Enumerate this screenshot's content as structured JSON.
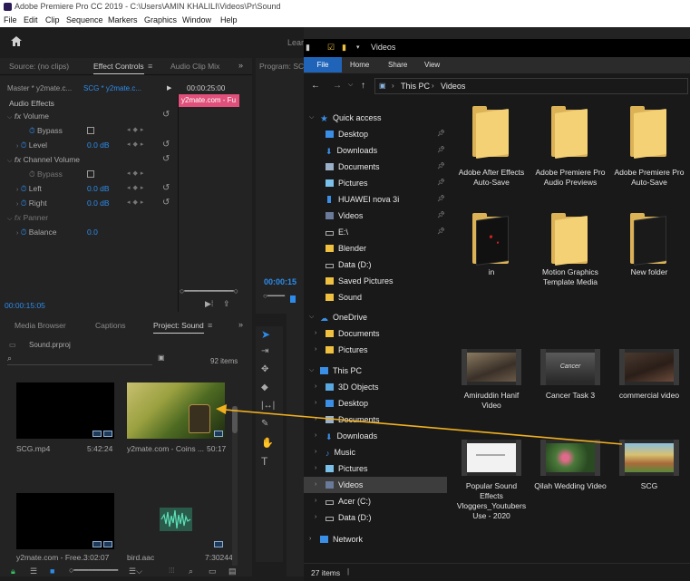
{
  "window_title": "Adobe Premiere Pro CC 2019 - C:\\Users\\AMIN KHALILI\\Videos\\Pr\\Sound",
  "menu": [
    "File",
    "Edit",
    "Clip",
    "Sequence",
    "Markers",
    "Graphics",
    "Window",
    "Help"
  ],
  "workspace_label": "Lear",
  "source_panel": {
    "tabs": [
      "Source: (no clips)",
      "Effect Controls",
      "Audio Clip Mix"
    ],
    "master_label": "Master * y2mate.c...",
    "seq_label": "SCG * y2mate.c...",
    "time": "00:00:25:00",
    "clip_label": "y2mate.com - Fu",
    "section": "Audio Effects",
    "volume": "Volume",
    "bypass": "Bypass",
    "level": "Level",
    "level_val": "0.0 dB",
    "channel_volume": "Channel Volume",
    "left": "Left",
    "left_val": "0.0 dB",
    "right": "Right",
    "right_val": "0.0 dB",
    "panner": "Panner",
    "balance": "Balance",
    "balance_val": "0.0",
    "timecode": "00:00:15:05"
  },
  "program_panel": {
    "tab": "Program: SC",
    "timecode": "00:00:15"
  },
  "project_panel": {
    "tabs": [
      "Media Browser",
      "Captions",
      "Project: Sound"
    ],
    "project_file": "Sound.prproj",
    "items_count": "92 items",
    "clips": [
      {
        "name": "SCG.mp4",
        "duration": "5:42:24"
      },
      {
        "name": "y2mate.com - Coins ...",
        "duration": "50:17"
      },
      {
        "name": "y2mate.com - Free...",
        "duration": "3:02:07"
      },
      {
        "name": "bird.aac",
        "duration": "7:30244"
      }
    ]
  },
  "explorer": {
    "title": "Videos",
    "ribbon_tabs": [
      "File",
      "Home",
      "Share",
      "View"
    ],
    "address": [
      "This PC",
      "Videos"
    ],
    "nav": {
      "quick_access": "Quick access",
      "quick_items": [
        "Desktop",
        "Downloads",
        "Documents",
        "Pictures",
        "HUAWEI nova 3i",
        "Videos",
        "E:\\",
        "Blender",
        "Data (D:)",
        "Saved Pictures",
        "Sound"
      ],
      "onedrive": "OneDrive",
      "onedrive_items": [
        "Documents",
        "Pictures"
      ],
      "this_pc": "This PC",
      "pc_items": [
        "3D Objects",
        "Desktop",
        "Documents",
        "Downloads",
        "Music",
        "Pictures",
        "Videos",
        "Acer (C:)",
        "Data (D:)"
      ],
      "network": "Network"
    },
    "files": [
      {
        "name": "Adobe After Effects Auto-Save",
        "kind": "folder"
      },
      {
        "name": "Adobe Premiere Pro Audio Previews",
        "kind": "folder"
      },
      {
        "name": "Adobe Premiere Pro Auto-Save",
        "kind": "folder"
      },
      {
        "name": "in",
        "kind": "folder-dark"
      },
      {
        "name": "Motion Graphics Template Media",
        "kind": "folder"
      },
      {
        "name": "New folder",
        "kind": "folder-dark"
      },
      {
        "name": "Amiruddin Hanif Video",
        "kind": "video"
      },
      {
        "name": "Cancer Task 3",
        "kind": "video"
      },
      {
        "name": "commercial video",
        "kind": "video"
      },
      {
        "name": "Popular Sound Effects Vloggers_Youtubers Use - 2020",
        "kind": "video"
      },
      {
        "name": "Qilah Wedding Video",
        "kind": "video"
      },
      {
        "name": "SCG",
        "kind": "video"
      }
    ],
    "status": "27 items",
    "thumb_text": "Cancer"
  },
  "colors": {
    "accent": "#2d8ceb",
    "clip_pink": "#e0507a",
    "arrow": "#f0b020",
    "folder": "#f5d176"
  }
}
